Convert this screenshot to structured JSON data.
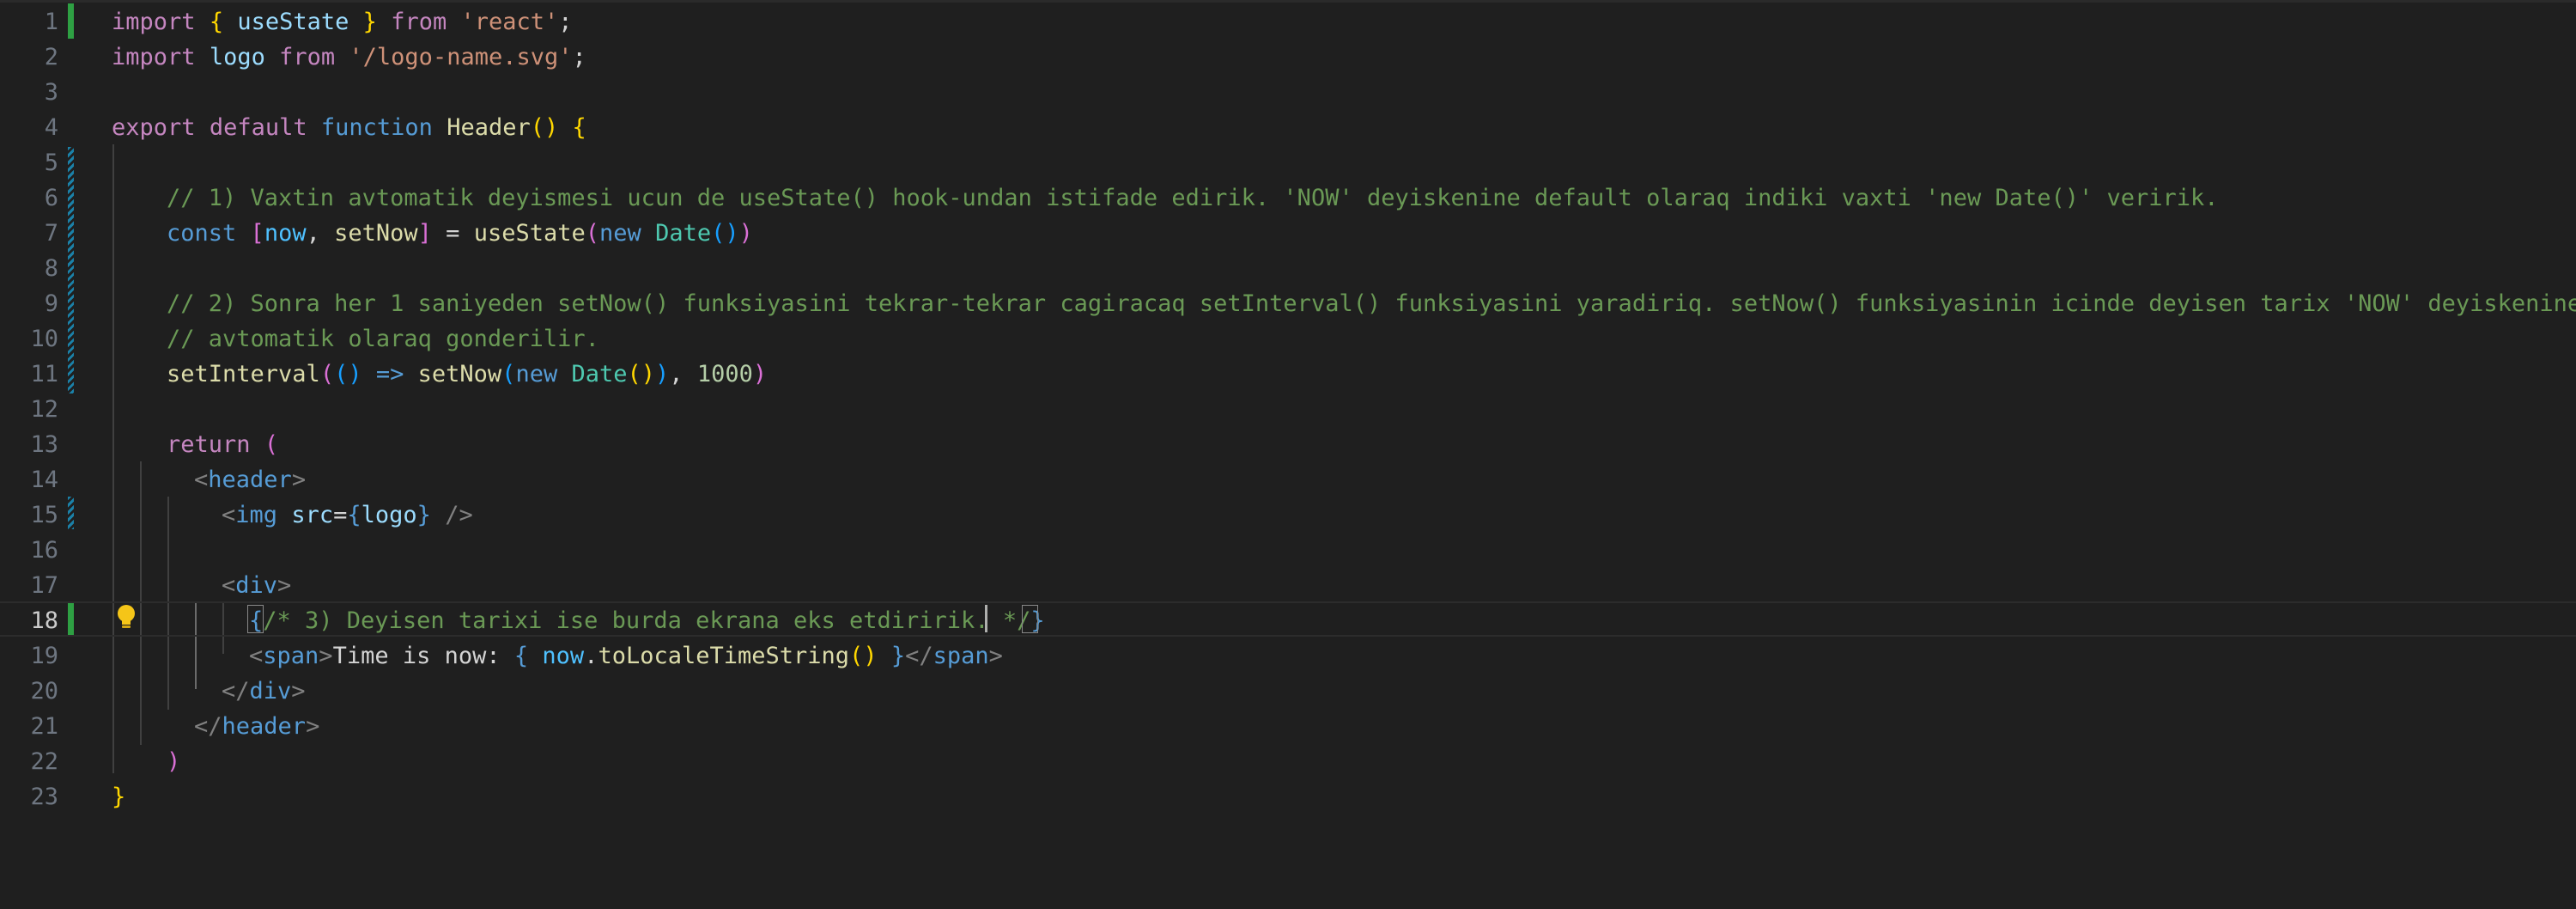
{
  "editor": {
    "language": "javascriptreact",
    "current_line": 18,
    "line_numbers": [
      "1",
      "2",
      "3",
      "4",
      "5",
      "6",
      "7",
      "8",
      "9",
      "10",
      "11",
      "12",
      "13",
      "14",
      "15",
      "16",
      "17",
      "18",
      "19",
      "20",
      "21",
      "22",
      "23"
    ]
  },
  "colors": {
    "background": "#1f1f1f",
    "keyword": "#c586c0",
    "storage": "#569cd6",
    "function": "#dcdcaa",
    "variable": "#9cdcfe",
    "string": "#ce9178",
    "comment": "#6a9955",
    "number": "#b5cea8",
    "gutter_added": "#2ea043",
    "gutter_modified": "#1b81a8"
  },
  "tokens": {
    "import": "import",
    "from": "from",
    "export": "export",
    "default": "default",
    "function": "function",
    "const": "const",
    "new": "new",
    "return": "return",
    "useState": "useState",
    "react_str": "'react'",
    "logo": "logo",
    "logo_path": "'/logo-name.svg'",
    "Header": "Header",
    "comment1": "// 1) Vaxtin avtomatik deyismesi ucun de useState() hook-undan istifade edirik. 'NOW' deyiskenine default olaraq indiki vaxti 'new Date()' veririk.",
    "now": "now",
    "setNow": "setNow",
    "Date": "Date",
    "comment2a": "// 2) Sonra her 1 saniyeden setNow() funksiyasini tekrar-tekrar cagiracaq setInterval() funksiyasini yaradiriq. setNow() funksiyasinin icinde deyisen tarix 'NOW' deyiskenine",
    "comment2b": "// avtomatik olaraq gonderilir.",
    "setInterval": "setInterval",
    "interval_ms": "1000",
    "header_tag": "header",
    "img_tag": "img",
    "src_attr": "src",
    "div_tag": "div",
    "comment3": "/* 3) Deyisen tarixi ise burda ekrana eks etdiririk. ",
    "comment3_end": "*/",
    "span_tag": "span",
    "time_text": "Time is now: ",
    "toLocaleTimeString": "toLocaleTimeString"
  },
  "icons": {
    "lightbulb": "lightbulb-icon"
  }
}
